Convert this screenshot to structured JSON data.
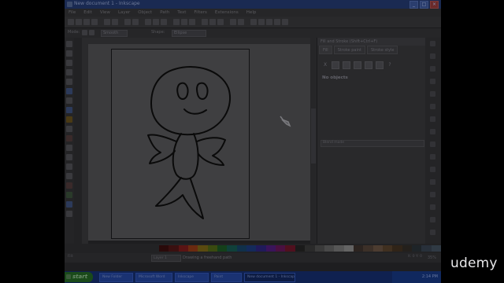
{
  "window": {
    "title": "New document 1 - Inkscape",
    "buttons": [
      "_",
      "□",
      "×"
    ]
  },
  "menus": [
    "File",
    "Edit",
    "View",
    "Layer",
    "Object",
    "Path",
    "Text",
    "Filters",
    "Extensions",
    "Help"
  ],
  "controls": {
    "mode_label": "Mode:",
    "smoothing_value": "Smooth",
    "shape_label": "Shape:",
    "shape_value": "Ellipse"
  },
  "dock": {
    "title": "Fill and Stroke (Shift+Ctrl+F)",
    "tabs": [
      "Fill",
      "Stroke paint",
      "Stroke style"
    ],
    "paint_symbols": [
      "X",
      "?"
    ],
    "empty_message": "No objects",
    "blend_label": "Blend mode"
  },
  "palette": [
    "#2a0a0a",
    "#3a1010",
    "#5a1414",
    "#6a2a10",
    "#5a4a10",
    "#3a4a10",
    "#14401a",
    "#10403a",
    "#10304a",
    "#142a5a",
    "#201a5a",
    "#3a145a",
    "#4a1040",
    "#50101e",
    "#1a1a1a",
    "#2a2a2a",
    "#3a3a3a",
    "#484848",
    "#565656",
    "#646464",
    "#2c2420",
    "#3c3028",
    "#4c3c30",
    "#403020",
    "#302418",
    "#24201c",
    "#1e2428",
    "#28303a",
    "#303a44"
  ],
  "status": {
    "fill_label": "Fill:",
    "layer": "Layer 1",
    "message": "Drawing a freehand path",
    "coords": "X: 0  Y: 0",
    "zoom": "35%"
  },
  "taskbar": {
    "start": "start",
    "tasks": [
      "New Folder",
      "Microsoft Word",
      "Inkscape",
      "Paint",
      "New document 1 - Inkscape"
    ],
    "clock": "2:14 PM"
  },
  "watermark": "udemy"
}
